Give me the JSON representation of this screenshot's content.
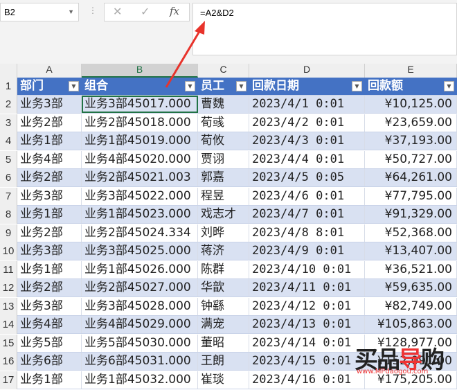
{
  "name_box": "B2",
  "formula": "=A2&D2",
  "fx_label": "fx",
  "cancel_icon": "✕",
  "enter_icon": "✓",
  "columns": [
    "A",
    "B",
    "C",
    "D",
    "E"
  ],
  "headers": [
    "部门",
    "组合",
    "员工",
    "回款日期",
    "回款额"
  ],
  "rows": [
    [
      "2",
      "业务3部",
      "业务3部45017.000",
      "曹魏",
      "2023/4/1  0:01",
      "¥10,125.00"
    ],
    [
      "3",
      "业务2部",
      "业务2部45018.000",
      "荀彧",
      "2023/4/2  0:01",
      "¥23,659.00"
    ],
    [
      "4",
      "业务1部",
      "业务1部45019.000",
      "荀攸",
      "2023/4/3  0:01",
      "¥37,193.00"
    ],
    [
      "5",
      "业务4部",
      "业务4部45020.000",
      "贾诩",
      "2023/4/4  0:01",
      "¥50,727.00"
    ],
    [
      "6",
      "业务2部",
      "业务2部45021.003",
      "郭嘉",
      "2023/4/5  0:05",
      "¥64,261.00"
    ],
    [
      "7",
      "业务3部",
      "业务3部45022.000",
      "程昱",
      "2023/4/6  0:01",
      "¥77,795.00"
    ],
    [
      "8",
      "业务1部",
      "业务1部45023.000",
      "戏志才",
      "2023/4/7  0:01",
      "¥91,329.00"
    ],
    [
      "9",
      "业务2部",
      "业务2部45024.334",
      "刘晔",
      "2023/4/8  8:01",
      "¥52,368.00"
    ],
    [
      "10",
      "业务3部",
      "业务3部45025.000",
      "蒋济",
      "2023/4/9  0:01",
      "¥13,407.00"
    ],
    [
      "11",
      "业务1部",
      "业务1部45026.000",
      "陈群",
      "2023/4/10  0:01",
      "¥36,521.00"
    ],
    [
      "12",
      "业务2部",
      "业务2部45027.000",
      "华歆",
      "2023/4/11  0:01",
      "¥59,635.00"
    ],
    [
      "13",
      "业务3部",
      "业务3部45028.000",
      "钟繇",
      "2023/4/12  0:01",
      "¥82,749.00"
    ],
    [
      "14",
      "业务4部",
      "业务4部45029.000",
      "满宠",
      "2023/4/13  0:01",
      "¥105,863.00"
    ],
    [
      "15",
      "业务5部",
      "业务5部45030.000",
      "董昭",
      "2023/4/14  0:01",
      "¥128,977.00"
    ],
    [
      "16",
      "业务6部",
      "业务6部45031.000",
      "王朗",
      "2023/4/15  0:01",
      "¥152,091.00"
    ],
    [
      "17",
      "业务1部",
      "业务1部45032.000",
      "崔琰",
      "2023/4/16  0:01",
      "¥175,205.00"
    ]
  ],
  "watermark": {
    "logo": "买品导购",
    "url": "www.MPdaogou.com"
  },
  "colors": {
    "header": "#4472c4",
    "band": "#d9e1f2",
    "select": "#217346",
    "arrow": "#e8332b"
  }
}
